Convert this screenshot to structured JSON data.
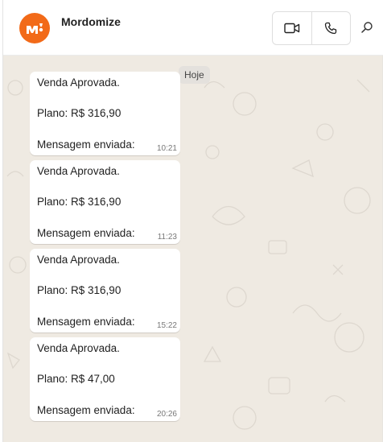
{
  "contact": {
    "name": "Mordomize",
    "avatar_color": "#f26a18"
  },
  "header_actions": [
    {
      "name": "video-call",
      "icon": "video-camera-icon"
    },
    {
      "name": "voice-call",
      "icon": "phone-icon"
    },
    {
      "name": "search",
      "icon": "search-icon"
    }
  ],
  "chat": {
    "date_label": "Hoje",
    "background_color": "#efeae2",
    "messages": [
      {
        "line1": "Venda Aprovada.",
        "line2": "Plano: R$ 316,90",
        "line3": "Mensagem enviada:",
        "time": "10:21"
      },
      {
        "line1": "Venda Aprovada.",
        "line2": "Plano: R$ 316,90",
        "line3": "Mensagem enviada:",
        "time": "11:23"
      },
      {
        "line1": "Venda Aprovada.",
        "line2": "Plano: R$ 316,90",
        "line3": "Mensagem enviada:",
        "time": "15:22"
      },
      {
        "line1": "Venda Aprovada.",
        "line2": "Plano: R$ 47,00",
        "line3": "Mensagem enviada:",
        "time": "20:26"
      }
    ]
  }
}
